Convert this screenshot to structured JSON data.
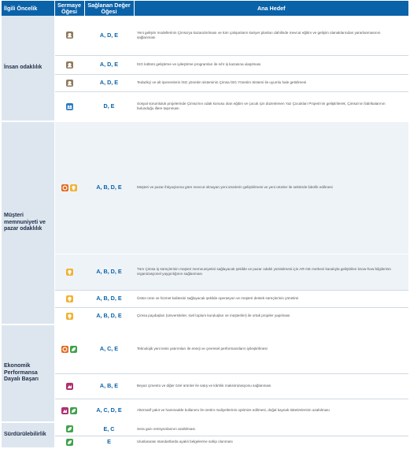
{
  "header": {
    "priority": "İlgili Öncelik",
    "capital": "Sermaye Öğesi",
    "value": "Sağlanan Değer Öğesi",
    "goal": "Ana Hedef"
  },
  "priorities": {
    "human": "İnsan odaklılık",
    "customer": "Müşteri memnuniyeti ve pazar odaklılık",
    "economic": "Ekonomik Performansa Dayalı Başarı",
    "sustain": "Sürdürülebilirlik"
  },
  "rows": [
    {
      "value": "A, D, E",
      "goal": "Yeni gelişim modellerinin Çimsa'ya kazandırılması ve tüm çalışanların kariyer planları dahilinde mevcut eğitim ve gelişim olanaklarından yararlanmasının sağlanması",
      "icons": [
        "human-capital-icon"
      ]
    },
    {
      "value": "A, D, E",
      "goal": "İSG kültürü geliştirme ve iyileştirme programları ile sıfır iş kazasına ulaşılması",
      "icons": [
        "human-capital-icon"
      ]
    },
    {
      "value": "A, D, E",
      "goal": "Tedarikçi ve alt işverenlerin İSG yönetim sisteminin Çimsa İSG Yönetim Sistemi ile uyumlu hale getirilmesi",
      "icons": [
        "human-capital-icon"
      ]
    },
    {
      "value": "D, E",
      "goal": "Sosyal sorumluluk projelerinde Çimsa'nın odak konusu olan eğitim ve çocuk için düzenlenen Yaz Çocukları Projesi'nin geliştirilerek, Çimsa'nın fabrikalarının bulunduğu illere taşınması",
      "icons": [
        "social-capital-icon"
      ]
    },
    {
      "value": "A, B, D, E",
      "goal": "Müşteri ve pazar ihtiyaçlarına göre mevcut olmayan yeni ürünlerin geliştirilmesi ve yeni ürünler ile sektörde liderlik edilmesi",
      "icons": [
        "customer-capital-icon",
        "intellectual-capital-icon"
      ]
    },
    {
      "value": "A, B, D, E",
      "goal": "Tüm Çimsa iş süreçlerinin müşteri memnuniyetini sağlayacak şekilde ve pazar odaklı yürütülmesi için AR-GE merkezi kanalıyla geliştirilen know-how bilgilerinin organizasyonel yaygınlığının sağlanması",
      "icons": [
        "intellectual-capital-icon"
      ]
    },
    {
      "value": "A, B, D, E",
      "goal": "Üstün ürün ve hizmet kalitesini sağlayacak şekilde operasyon ve müşteri destek süreçlerinin yönetimi",
      "icons": [
        "intellectual-capital-icon"
      ]
    },
    {
      "value": "A, B, D, E",
      "goal": "Çimsa paydaşları (üniversiteler, sivil toplum kuruluşları ve müşteriler) ile ortak projeler yapılması",
      "icons": [
        "intellectual-capital-icon"
      ]
    },
    {
      "value": "A, C, E",
      "goal": "Teknolojik yeni tesis yatırımları ile enerji ve çevresel performansların iyileştirilmesi",
      "icons": [
        "customer-capital-icon",
        "natural-capital-icon"
      ]
    },
    {
      "value": "A, B, E",
      "goal": "Beyaz çimento ve diğer özel ürünler ile satış ve kârlılık maksimizasyonu sağlanması",
      "icons": [
        "brand-capital-icon"
      ]
    },
    {
      "value": "A, C, D, E",
      "goal": "Alternatif yakıt ve hammadde kullanımı ile üretim maliyetlerinin optimize edilmesi, doğal kaynak tüketimlerinin azaltılması",
      "icons": [
        "brand-capital-icon",
        "natural-capital-icon"
      ]
    },
    {
      "value": "E, C",
      "goal": "Sera gazı emisyonlarının azaltılması",
      "icons": [
        "natural-capital-icon"
      ]
    },
    {
      "value": "E",
      "goal": "Uluslararası standartlarda ayaklı belgelerine sahip olunması",
      "icons": [
        "natural-capital-icon"
      ]
    }
  ],
  "colors": {
    "header_bg": "#0a62a9",
    "priority_bg": "#dde6ee",
    "value_text": "#0a62a9",
    "human_capital": "#8f7a5c",
    "social_capital": "#2a7ac0",
    "customer_capital": "#e56b1f",
    "intellectual_capital": "#f2b233",
    "brand_capital": "#b0306f",
    "natural_capital": "#3fa34d"
  }
}
